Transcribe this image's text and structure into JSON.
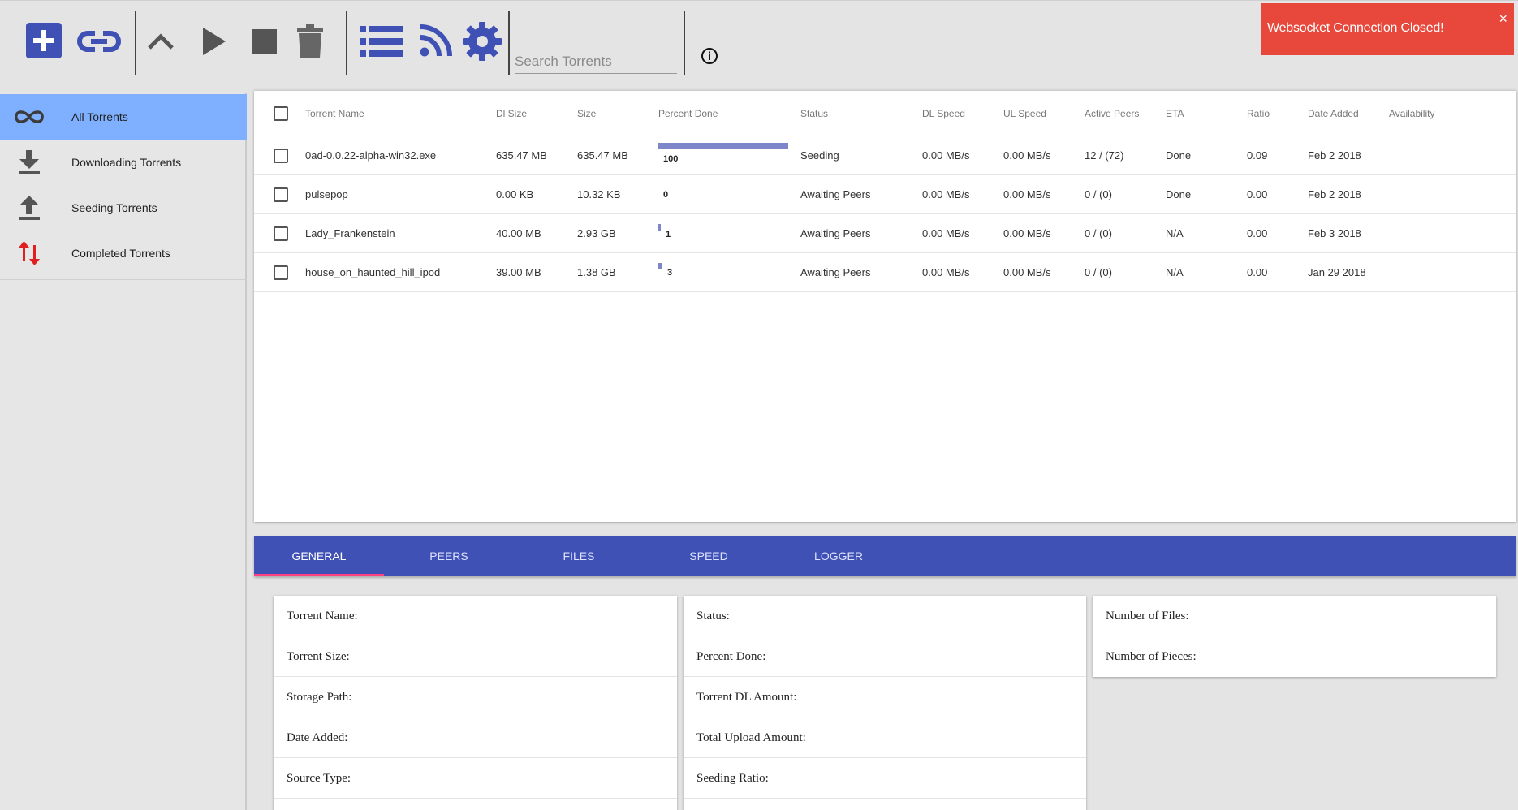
{
  "toolbar": {
    "buttons": [
      {
        "name": "add-torrent-button",
        "icon": "plus-square-icon"
      },
      {
        "name": "add-magnet-link-button",
        "icon": "link-icon"
      },
      {
        "name": "move-up-button",
        "icon": "chevron-up-icon"
      },
      {
        "name": "start-button",
        "icon": "play-icon"
      },
      {
        "name": "stop-button",
        "icon": "stop-icon"
      },
      {
        "name": "delete-button",
        "icon": "trash-icon"
      },
      {
        "name": "list-view-button",
        "icon": "list-icon"
      },
      {
        "name": "rss-button",
        "icon": "rss-icon"
      },
      {
        "name": "settings-button",
        "icon": "gear-icon"
      }
    ],
    "search_placeholder": "Search Torrents",
    "info_icon": "info-circle-icon",
    "accent_color": "#3f51b5",
    "icon_gray": "#555555"
  },
  "toast": {
    "message": "Websocket Connection Closed!",
    "close_label": "×",
    "color": "#e8483b"
  },
  "sidebar": {
    "items": [
      {
        "label": "All Torrents",
        "icon": "infinity-icon",
        "active": true
      },
      {
        "label": "Downloading Torrents",
        "icon": "download-icon",
        "active": false
      },
      {
        "label": "Seeding Torrents",
        "icon": "upload-icon",
        "active": false
      },
      {
        "label": "Completed Torrents",
        "icon": "up-down-arrows-icon",
        "active": false
      }
    ],
    "active_color": "#7fb0ff"
  },
  "table": {
    "headers": [
      "Torrent Name",
      "Dl Size",
      "Size",
      "Percent Done",
      "Status",
      "DL Speed",
      "UL Speed",
      "Active Peers",
      "ETA",
      "Ratio",
      "Date Added",
      "Availability"
    ],
    "rows": [
      {
        "name": "0ad-0.0.22-alpha-win32.exe",
        "dl_size": "635.47 MB",
        "size": "635.47 MB",
        "percent": "100",
        "percent_value": 100,
        "status": "Seeding",
        "dl_speed": "0.00 MB/s",
        "ul_speed": "0.00 MB/s",
        "peers": "12 / (72)",
        "eta": "Done",
        "ratio": "0.09",
        "date_added": "Feb 2 2018",
        "availability": ""
      },
      {
        "name": "pulsepop",
        "dl_size": "0.00 KB",
        "size": "10.32 KB",
        "percent": "0",
        "percent_value": 0,
        "status": "Awaiting Peers",
        "dl_speed": "0.00 MB/s",
        "ul_speed": "0.00 MB/s",
        "peers": "0 / (0)",
        "eta": "Done",
        "ratio": "0.00",
        "date_added": "Feb 2 2018",
        "availability": ""
      },
      {
        "name": "Lady_Frankenstein",
        "dl_size": "40.00 MB",
        "size": "2.93 GB",
        "percent": "1",
        "percent_value": 1,
        "status": "Awaiting Peers",
        "dl_speed": "0.00 MB/s",
        "ul_speed": "0.00 MB/s",
        "peers": "0 / (0)",
        "eta": "N/A",
        "ratio": "0.00",
        "date_added": "Feb 3 2018",
        "availability": ""
      },
      {
        "name": "house_on_haunted_hill_ipod",
        "dl_size": "39.00 MB",
        "size": "1.38 GB",
        "percent": "3",
        "percent_value": 3,
        "status": "Awaiting Peers",
        "dl_speed": "0.00 MB/s",
        "ul_speed": "0.00 MB/s",
        "peers": "0 / (0)",
        "eta": "N/A",
        "ratio": "0.00",
        "date_added": "Jan 29 2018",
        "availability": ""
      }
    ],
    "progress_color": "#7c86c8"
  },
  "details": {
    "tabs": [
      {
        "label": "General",
        "active": true
      },
      {
        "label": "Peers",
        "active": false
      },
      {
        "label": "Files",
        "active": false
      },
      {
        "label": "Speed",
        "active": false
      },
      {
        "label": "Logger",
        "active": false
      }
    ],
    "tabbar_color": "#3f51b5",
    "ink_color": "#ff4081",
    "col1": [
      "Torrent Name:",
      "Torrent Size:",
      "Storage Path:",
      "Date Added:",
      "Source Type:"
    ],
    "col2": [
      "Status:",
      "Percent Done:",
      "Torrent DL Amount:",
      "Total Upload Amount:",
      "Seeding Ratio:"
    ],
    "col3": [
      "Number of Files:",
      "Number of Pieces:"
    ]
  }
}
